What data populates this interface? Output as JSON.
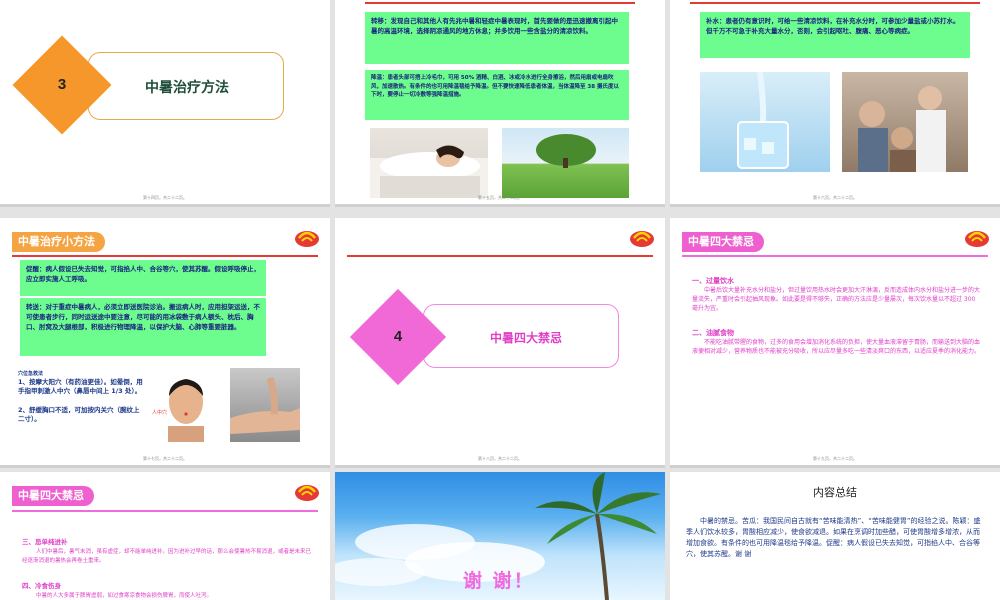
{
  "colors": {
    "orange": "#f5a443",
    "pink": "#ee5fcf",
    "green": "#6dfc8e",
    "red_line": "#e53935"
  },
  "slide1": {
    "number": "3",
    "title": "中暑治疗方法",
    "footer": "第十四页，共二十二页。"
  },
  "slide2": {
    "box1": "转移：发现自己和其他人有先兆中暑和轻症中暑表现时，首先要做的是迅速撤离引起中暑的高温环境，选择阴凉通风的地方休息；并多饮用一些含盐分的清凉饮料。",
    "box2": "降温：患者头部可捂上冷毛巾，可用 50% 酒精、白酒、冰或冷水进行全身擦浴，然后用扇或电扇吹风，加速散热。有条件的也可用降温毯给予降温。但不要快速降低患者体温，当体温降至 38 摄氏度以下时，要停止一切冷敷等强降温措施。",
    "footer": "第十五页，共二十二页。"
  },
  "slide3": {
    "box1": "补水：患者仍有意识时，可给一些清凉饮料，在补充水分时，可参加少量盐或小苏打水。但千万不可急于补充大量水分，否则，会引起呕吐、腹痛、恶心等病症。",
    "footer": "第十六页，共二十二页。"
  },
  "slide4": {
    "tab": "中暑治疗小方法",
    "box1": "促醒：病人假设已失去知觉，可指掐人中、合谷等穴，使其苏醒。假设呼吸停止，应立即实施人工呼吸。",
    "box2": "转送：对于重症中暑病人，必须立即送医院诊治。搬运病人时，应用担架运送，不可使患者步行，同时运送途中要注意，尽可能的用冰袋敷于病人额头、枕后、胸口、肘窝及大腿根部，积极进行物理降温，以保护大脑、心肺等重要脏器。",
    "aid_title": "穴位急救法",
    "aid1": "1、按摩大阳穴（有药油更佳）。如晕倒，用手指甲刺激人中穴（鼻唇中间上 1/3 处）。",
    "aid2": "2、舒缓胸口不适，可加按内关穴（腕纹上二寸）。",
    "renzhong_label": "人中穴",
    "footer": "第十七页，共二十二页。"
  },
  "slide5": {
    "number": "4",
    "title": "中暑四大禁忌",
    "footer": "第十八页，共二十二页。"
  },
  "slide6": {
    "tab": "中暑四大禁忌",
    "h1": "一、过量饮水",
    "p1": "中暑后饮大量补充水分和盐分，但过量饮用热水时会更加大汗淋漓，反而造成体内水分和盐分进一步的大量流失，严重时会引起抽风现象。如此要是得不够失，正确的方法应是少量屡次，每次饮水量以不超过 300 毫升为宜。",
    "h2": "二、油腻食物",
    "p2": "不能吃油腻带腥的食物，过多的食用会增加消化系统的负担，使大量血液滞留于胃肠，而输送到大脑的血液便相对减少，营养物质也不能被充分吸收，所以应尽量多吃一些清淡爽口的东西，以适应夏季的消化能力。",
    "footer": "第十九页，共二十二页。"
  },
  "slide7": {
    "tab": "中暑四大禁忌",
    "h3": "三、忌单纯进补",
    "p3": "人们中暑后，暑气未消，虽有虚症，却不能单纯进补。因为进补过早的话，那么会使暑热不易消退，或者是未来已经逐渐消退的暑热会再卷土重来。",
    "h4": "四、冷食伤身",
    "p4": "中暑的人大多属于脾胃虚弱，如过食寒凉食物会损伤脾胃，而使人吐泻。"
  },
  "slide8": {
    "thanks": "谢 谢！"
  },
  "slide9": {
    "title": "内容总结",
    "body": "中暑的禁忌。苦瓜：我国民间自古就有“苦味能清热”、“苦味能健胃”的经验之说。陈颖：盛季人们饮水较多，胃酸相应减少，使食欲减退。如果在烹调时加些醋，可使胃酸增多增浓，从而增加食欲。有条件的也可用降温毯给予降温。促醒：病人假设已失去知觉，可指掐人中、合谷等穴，使其苏醒。谢 谢"
  }
}
